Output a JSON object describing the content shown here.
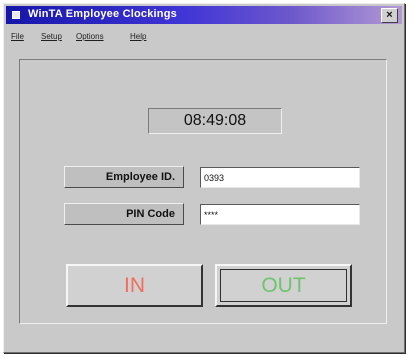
{
  "window": {
    "title": "WinTA Employee Clockings",
    "close_icon": "close-icon",
    "app_icon": "window-icon"
  },
  "menu": {
    "items": [
      {
        "label": "File"
      },
      {
        "label": "Setup"
      },
      {
        "label": "Options"
      },
      {
        "label": "Help"
      }
    ]
  },
  "clock": {
    "time": "08:49:08"
  },
  "form": {
    "employee_id_label": "Employee ID.",
    "employee_id_value": "0393",
    "pin_code_label": "PIN Code",
    "pin_code_value": "****"
  },
  "actions": {
    "in_label": "IN",
    "out_label": "OUT"
  },
  "colors": {
    "in": "#f16f5d",
    "out": "#6fc46f",
    "title_bar_start": "#1616a9",
    "title_bar_end": "#b49ad4"
  }
}
